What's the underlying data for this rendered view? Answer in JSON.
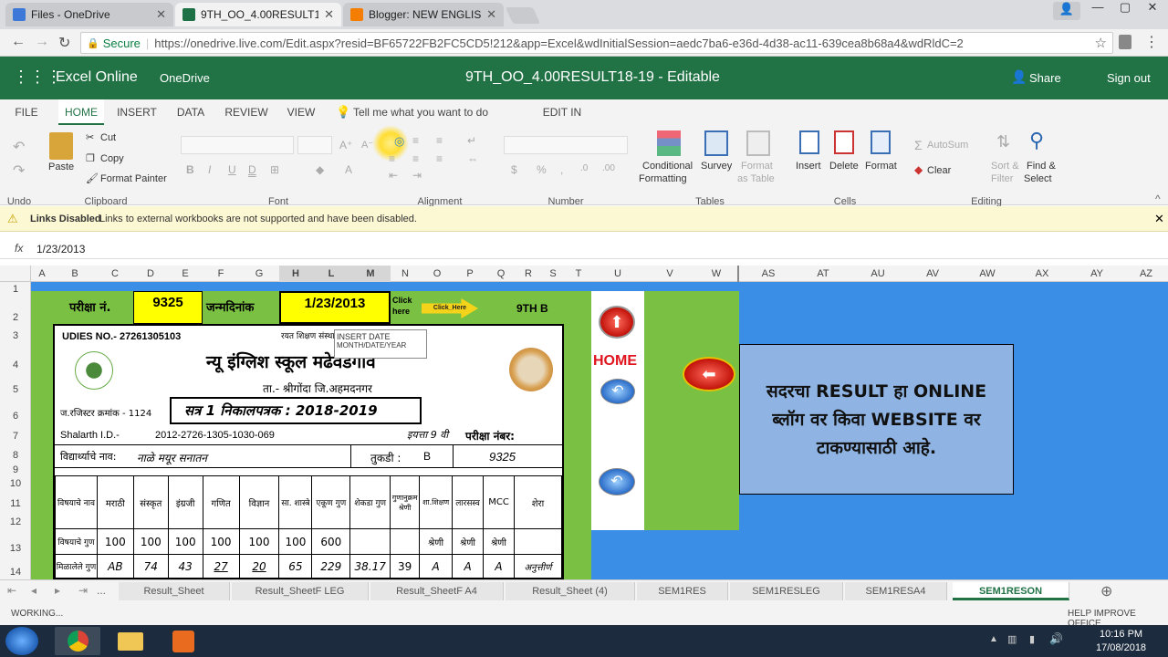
{
  "browser": {
    "tabs": [
      {
        "label": "Files - OneDrive",
        "color": "#3b78d8"
      },
      {
        "label": "9TH_OO_4.00RESULT18-1",
        "color": "#1e7145"
      },
      {
        "label": "Blogger: NEW ENGLISH S",
        "color": "#f57d00"
      }
    ],
    "secure": "Secure",
    "url": "https://onedrive.live.com/Edit.aspx?resid=BF65722FB2FC5CD5!212&app=Excel&wdInitialSession=aedc7ba6-e36d-4d38-ac11-639cea8b68a4&wdRldC=2"
  },
  "app": {
    "name": "Excel Online",
    "service": "OneDrive",
    "doc_title": "9TH_OO_4.00RESULT18-19 - Editable",
    "share": "Share",
    "signout": "Sign out"
  },
  "ribbon": {
    "tabs": [
      "FILE",
      "HOME",
      "INSERT",
      "DATA",
      "REVIEW",
      "VIEW"
    ],
    "tell_me": "Tell me what you want to do",
    "edit_in_excel": "EDIT IN EXCEL",
    "undo_group": "Undo",
    "paste": "Paste",
    "cut": "Cut",
    "copy": "Copy",
    "format_painter": "Format Painter",
    "clipboard_group": "Clipboard",
    "font_group": "Font",
    "alignment_group": "Alignment",
    "number_group": "Number",
    "conditional": "Conditional",
    "formatting": "Formatting",
    "survey": "Survey",
    "format_as": "Format",
    "as_table": "as Table",
    "tables_group": "Tables",
    "insert": "Insert",
    "delete": "Delete",
    "format": "Format",
    "cells_group": "Cells",
    "autosum": "AutoSum",
    "clear": "Clear",
    "sort": "Sort &",
    "filter": "Filter",
    "find": "Find &",
    "select": "Select",
    "editing_group": "Editing"
  },
  "message": {
    "title": "Links Disabled",
    "text": "Links to external workbooks are not supported and have been disabled."
  },
  "formula": {
    "fx": "fx",
    "value": "1/23/2013"
  },
  "columns": [
    "A",
    "B",
    "C",
    "D",
    "E",
    "F",
    "G",
    "H",
    "L",
    "M",
    "N",
    "O",
    "P",
    "Q",
    "R",
    "S",
    "T",
    "U",
    "V",
    "W",
    "AS",
    "AT",
    "AU",
    "AV",
    "AW",
    "AX",
    "AY",
    "AZ"
  ],
  "rows": [
    "1",
    "2",
    "3",
    "4",
    "5",
    "6",
    "7",
    "8",
    "9",
    "10",
    "11",
    "12",
    "13",
    "14"
  ],
  "sheet": {
    "exam_no_label": "परीक्षा नं.",
    "exam_no": "9325",
    "dob_label": "जन्मदिनांक",
    "dob": "1/23/2013",
    "click_here": "Click here",
    "click_btn": "Click_Here",
    "class_label": "9TH B",
    "udise": "UDIES NO.- 27261305103",
    "trust": "रयत शिक्षण संस्था",
    "tooltip_title": "INSERT DATE",
    "tooltip_format": "MONTH/DATE/YEAR",
    "school": "न्यू इंग्लिश स्कूल मढेवडगाव",
    "taluka": "ता.- श्रीगोंदा  जि.अहमदनगर",
    "reg_no": "ज.रजिस्टर क्रमांक -  1124",
    "term": "सत्र 1 निकालपत्रक :   2018-2019",
    "saral": "Shalarth I.D.-",
    "saral_id": "2012-2726-1305-1030-069",
    "std": "इयत्ता 9 वी",
    "exam_num_label": "परीक्षा नंबर:",
    "student_label": "विद्यार्थ्याचे नाव:",
    "student": "नाळे मयूर सनातन",
    "division_label": "तुकडी :",
    "division": "B",
    "exam_num": "9325",
    "headers": [
      "विषयाचे नाव",
      "मराठी",
      "संस्कृत",
      "इंग्रजी",
      "गणित",
      "विज्ञान",
      "सा. शास्त्रे",
      "एकूण गुण",
      "शेकडा गुण",
      "गुणानुक्रम श्रेणी",
      "शा.शिक्षण",
      "लारसस्व",
      "MCC",
      "शेरा"
    ],
    "row_total": [
      "विषयाचे गुण",
      "100",
      "100",
      "100",
      "100",
      "100",
      "100",
      "600",
      "",
      "",
      "श्रेणी",
      "श्रेणी",
      "श्रेणी",
      ""
    ],
    "row_obtained": [
      "मिळालेले गुण",
      "AB",
      "74",
      "43",
      "27",
      "20",
      "65",
      "229",
      "38.17",
      "39",
      "A",
      "A",
      "A",
      "अनुत्तीर्ण"
    ],
    "home": "HOME",
    "info": "सदरचा RESULT हा ONLINE ब्लॉग वर किवा WEBSITE वर टाकण्यासाठी आहे."
  },
  "sheet_tabs": [
    "Result_Sheet",
    "Result_SheetF LEG",
    "Result_SheetF A4",
    "Result_Sheet (4)",
    "SEM1RES",
    "SEM1RESLEG",
    "SEM1RESA4",
    "SEM1RESON"
  ],
  "status": {
    "left": "WORKING...",
    "right": "HELP IMPROVE OFFICE"
  },
  "taskbar": {
    "time": "10:16 PM",
    "date": "17/08/2018"
  },
  "colors": {
    "excel_green": "#217346",
    "sheet_green": "#7ac143",
    "sheet_blue": "#3a8ee6",
    "yellow": "#ffff00"
  }
}
